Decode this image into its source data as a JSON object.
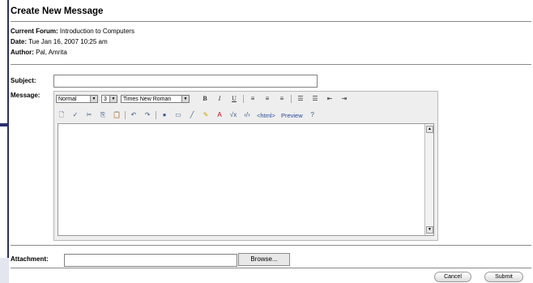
{
  "page": {
    "title": "Create New Message",
    "forum_label": "Current Forum:",
    "forum_value": "Introduction to Computers",
    "date_label": "Date:",
    "date_value": "Tue Jan 16, 2007 10:25 am",
    "author_label": "Author:",
    "author_value": "Pal, Amrita"
  },
  "form": {
    "subject_label": "Subject:",
    "subject_value": "",
    "message_label": "Message:",
    "attachment_label": "Attachment:",
    "attachment_value": "",
    "browse_label": "Browse...",
    "cancel_label": "Cancel",
    "submit_label": "Submit"
  },
  "editor": {
    "format_select": "Normal",
    "size_select": "3",
    "font_select": "Times New Roman",
    "bold": "B",
    "italic": "I",
    "underline": "U",
    "html_button": "<html>",
    "preview_button": "Preview",
    "icons": [
      "print-preview-icon",
      "spellcheck-icon",
      "cut-icon",
      "copy-icon",
      "paste-icon",
      "undo-icon",
      "redo-icon",
      "link-icon",
      "table-icon",
      "line-icon",
      "highlight-icon",
      "font-color-icon",
      "equation-icon",
      "code-icon",
      "help-icon"
    ]
  }
}
